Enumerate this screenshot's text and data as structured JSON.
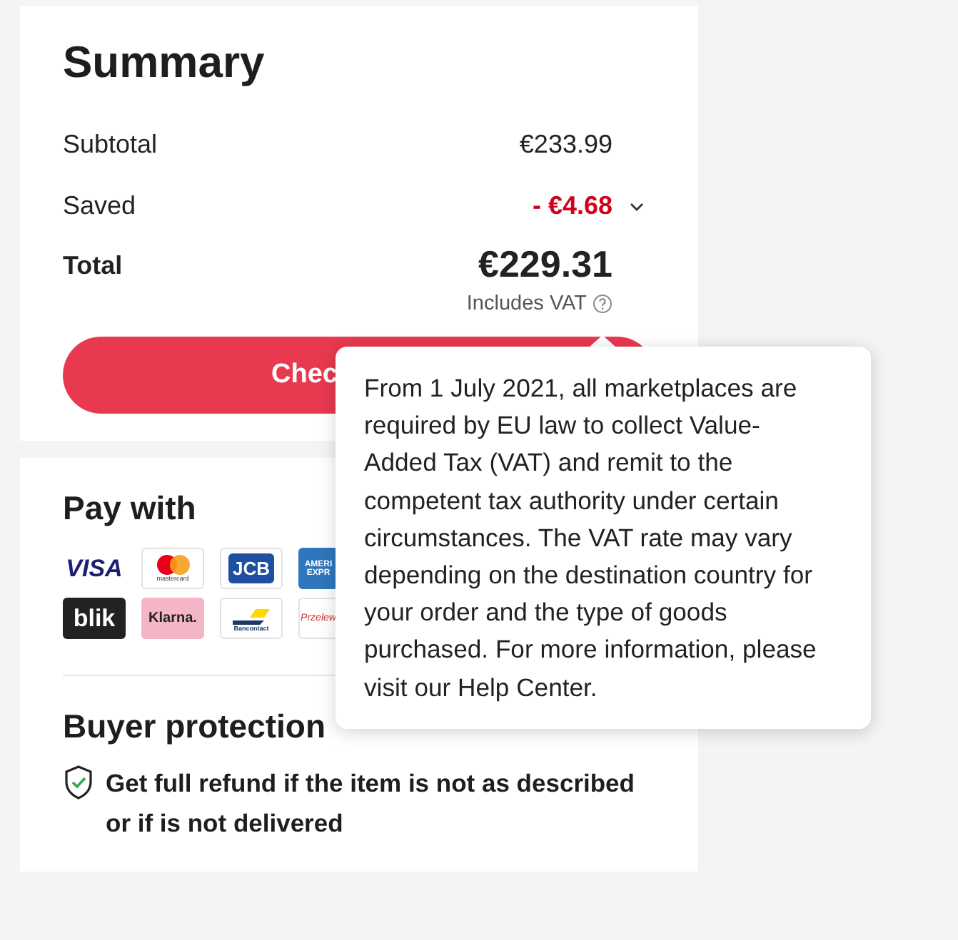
{
  "summary": {
    "title": "Summary",
    "rows": [
      {
        "kind": "plain",
        "label": "Subtotal",
        "value": "€233.99"
      },
      {
        "kind": "discount",
        "label": "Saved",
        "value": "- €4.68",
        "expanded": false
      },
      {
        "kind": "total",
        "label": "Total",
        "value": "€229.31",
        "note": "Includes VAT"
      }
    ],
    "checkout_button": "Chec"
  },
  "payment": {
    "title": "Pay with",
    "methods": [
      {
        "kind": "visa",
        "label": "VISA"
      },
      {
        "kind": "mastercard",
        "label": "mastercard"
      },
      {
        "kind": "jcb",
        "label": "JCB"
      },
      {
        "kind": "amex",
        "label": "AMERI EXPR"
      },
      {
        "kind": "blik",
        "label": "blik"
      },
      {
        "kind": "klarna",
        "label": "Klarna."
      },
      {
        "kind": "bancontact",
        "label": "Bancontact"
      },
      {
        "kind": "przelewy",
        "label": "Przelew"
      }
    ],
    "protection_title": "Buyer protection",
    "protection_text": "Get full refund if the item is not as described or if is not delivered"
  },
  "tooltip": {
    "text": "From 1 July 2021, all marketplaces are required by EU law to collect Value-Added Tax (VAT) and remit to the competent tax authority under certain circumstances. The VAT rate may vary depending on the destination country for your order and the type of goods purchased. For more information, please visit our Help Center."
  }
}
